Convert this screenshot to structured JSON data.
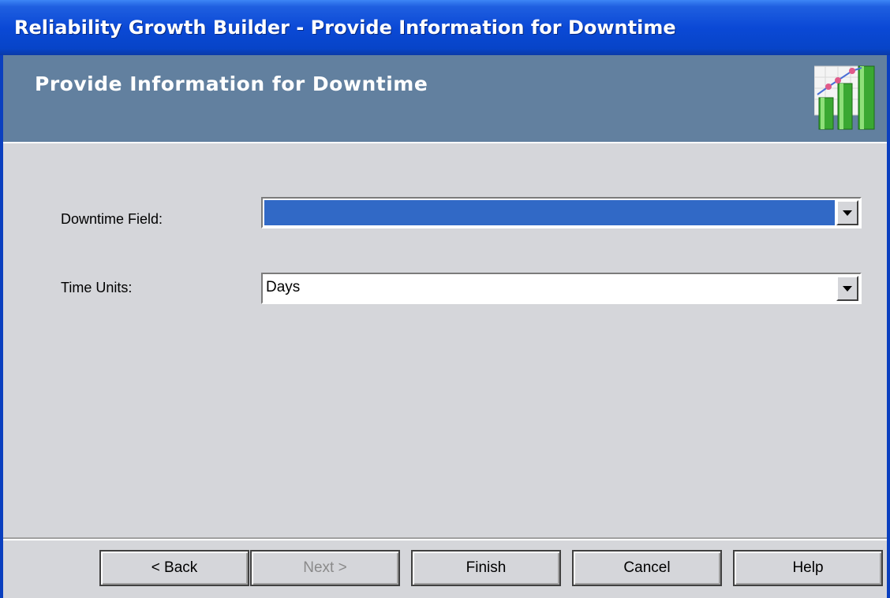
{
  "window": {
    "title": "Reliability Growth Builder - Provide Information for Downtime"
  },
  "header": {
    "title": "Provide Information for Downtime",
    "icon": "growth-chart-icon"
  },
  "form": {
    "downtime_field": {
      "label": "Downtime Field:",
      "value": ""
    },
    "time_units": {
      "label": "Time Units:",
      "value": "Days"
    }
  },
  "buttons": {
    "back": "< Back",
    "next": "Next >",
    "finish": "Finish",
    "cancel": "Cancel",
    "help": "Help"
  },
  "colors": {
    "title_bar": "#0b49d6",
    "header_band": "#62809f",
    "selection": "#3169c6",
    "dialog_bg": "#d5d6da"
  }
}
